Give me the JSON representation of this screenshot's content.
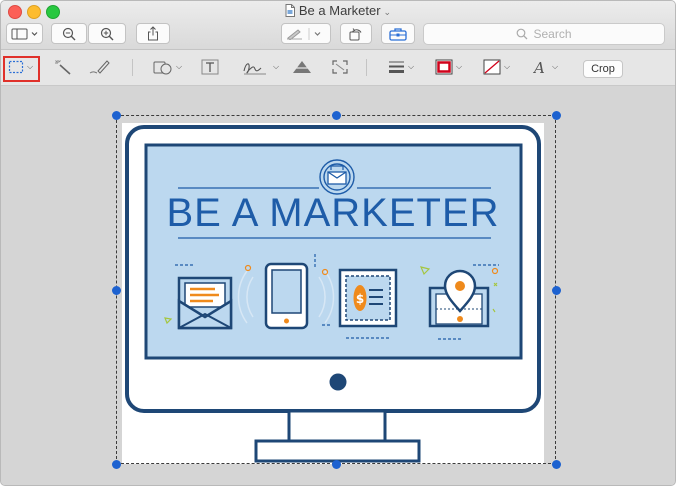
{
  "window": {
    "title": "Be a Marketer",
    "traffic_lights": {
      "close": "#fc5f57",
      "minimize": "#fdbc2e",
      "zoom": "#28c840"
    }
  },
  "toolbar": {
    "search_placeholder": "Search",
    "buttons": [
      "sidebar-toggle-icon",
      "zoom-out-icon",
      "zoom-in-icon",
      "share-icon",
      "pen-highlight-icon",
      "rotate-icon",
      "toolbox-icon"
    ]
  },
  "markup_toolbar": {
    "crop_label": "Crop",
    "tools": [
      "rectangular-selection-icon",
      "instant-alpha-icon",
      "sketch-icon",
      "shapes-icon",
      "text-icon",
      "sign-icon",
      "adjust-color-icon",
      "adjust-size-icon",
      "line-style-icon",
      "border-color-icon",
      "fill-color-icon",
      "text-style-icon"
    ],
    "active_tool": "rectangular-selection-icon",
    "border_color": "#d0021b"
  },
  "image": {
    "headline": "BE A MARKETER",
    "colors": {
      "screen": "#bcd8ef",
      "outline": "#1e4776",
      "accent": "#ef8a1c",
      "text": "#1e5ca8",
      "lime": "#a5c640"
    }
  }
}
